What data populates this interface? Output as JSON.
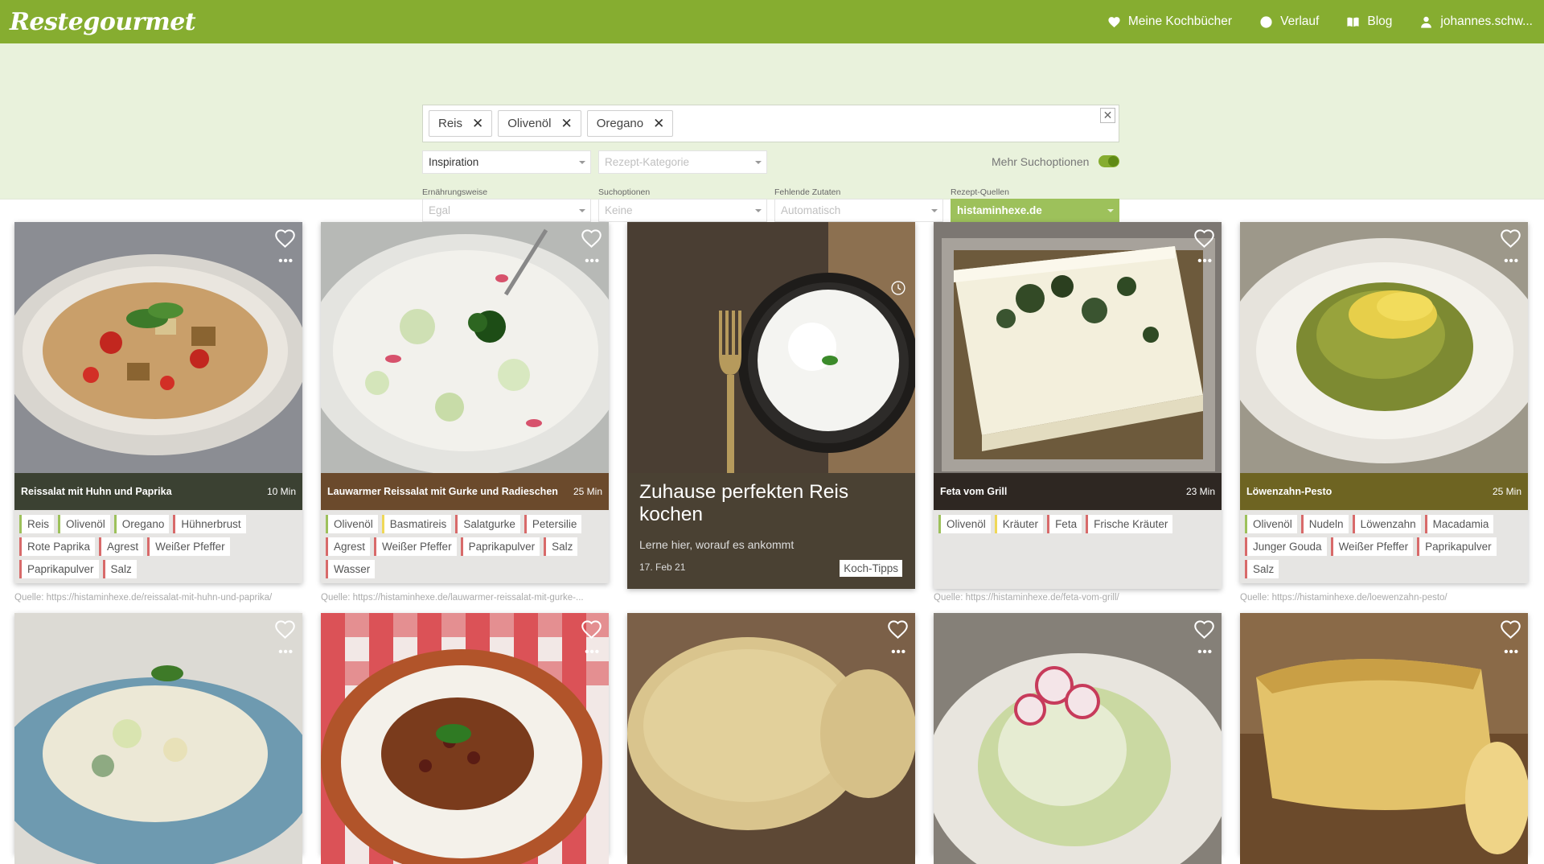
{
  "app": {
    "logo": "Restegourmet"
  },
  "nav": {
    "cookbooks": "Meine Kochbücher",
    "history": "Verlauf",
    "blog": "Blog",
    "user": "johannes.schw..."
  },
  "search": {
    "chips": [
      "Reis",
      "Olivenöl",
      "Oregano"
    ],
    "mode": "Inspiration",
    "category_placeholder": "Rezept-Kategorie",
    "more_options_label": "Mehr Suchoptionen",
    "diet_label": "Ernährungsweise",
    "diet_value": "Egal",
    "options_label": "Suchoptionen",
    "options_value": "Keine",
    "missing_label": "Fehlende Zutaten",
    "missing_value": "Automatisch",
    "sources_label": "Rezept-Quellen",
    "sources_value": "histaminhexe.de"
  },
  "colors": {
    "brand": "#86ad30",
    "panel": "#e9f2dc",
    "tag_green": "#9dc15b",
    "tag_red": "#d86a6a",
    "tag_yellow": "#efd857"
  },
  "cards": [
    {
      "title": "Reissalat mit Huhn und Paprika",
      "time": "10 Min",
      "bar_color": "#3b4132",
      "tags": [
        {
          "label": "Reis",
          "status": "green"
        },
        {
          "label": "Olivenöl",
          "status": "green"
        },
        {
          "label": "Oregano",
          "status": "green"
        },
        {
          "label": "Hühnerbrust",
          "status": "red"
        },
        {
          "label": "Rote Paprika",
          "status": "red"
        },
        {
          "label": "Agrest",
          "status": "red"
        },
        {
          "label": "Weißer Pfeffer",
          "status": "red"
        },
        {
          "label": "Paprikapulver",
          "status": "red"
        },
        {
          "label": "Salz",
          "status": "red"
        }
      ],
      "source": "Quelle: https://histaminhexe.de/reissalat-mit-huhn-und-paprika/"
    },
    {
      "title": "Lauwarmer Reissalat mit Gurke und Radieschen",
      "time": "25 Min",
      "bar_color": "#6b4a2c",
      "tags": [
        {
          "label": "Olivenöl",
          "status": "green"
        },
        {
          "label": "Basmatireis",
          "status": "yellow"
        },
        {
          "label": "Salatgurke",
          "status": "red"
        },
        {
          "label": "Petersilie",
          "status": "red"
        },
        {
          "label": "Agrest",
          "status": "red"
        },
        {
          "label": "Weißer Pfeffer",
          "status": "red"
        },
        {
          "label": "Paprikapulver",
          "status": "red"
        },
        {
          "label": "Salz",
          "status": "red"
        },
        {
          "label": "Wasser",
          "status": "red"
        }
      ],
      "source": "Quelle: https://histaminhexe.de/lauwarmer-reissalat-mit-gurke-..."
    },
    {
      "title": "Feta vom Grill",
      "time": "23 Min",
      "bar_color": "#2e2722",
      "tags": [
        {
          "label": "Olivenöl",
          "status": "green"
        },
        {
          "label": "Kräuter",
          "status": "yellow"
        },
        {
          "label": "Feta",
          "status": "red"
        },
        {
          "label": "Frische Kräuter",
          "status": "red"
        }
      ],
      "source": "Quelle: https://histaminhexe.de/feta-vom-grill/"
    },
    {
      "title": "Löwenzahn-Pesto",
      "time": "25 Min",
      "bar_color": "#6e6422",
      "tags": [
        {
          "label": "Olivenöl",
          "status": "green"
        },
        {
          "label": "Nudeln",
          "status": "red"
        },
        {
          "label": "Löwenzahn",
          "status": "red"
        },
        {
          "label": "Macadamia",
          "status": "red"
        },
        {
          "label": "Junger Gouda",
          "status": "red"
        },
        {
          "label": "Weißer Pfeffer",
          "status": "red"
        },
        {
          "label": "Paprikapulver",
          "status": "red"
        },
        {
          "label": "Salz",
          "status": "red"
        }
      ],
      "source": "Quelle: https://histaminhexe.de/loewenzahn-pesto/"
    }
  ],
  "article": {
    "title": "Zuhause perfekten Reis kochen",
    "subtitle": "Lerne hier, worauf es ankommt",
    "date": "17. Feb 21",
    "badge": "Koch-Tipps"
  },
  "icons": {
    "favorite": "heart-icon",
    "more": "more-dots-icon",
    "clock": "clock-icon"
  }
}
